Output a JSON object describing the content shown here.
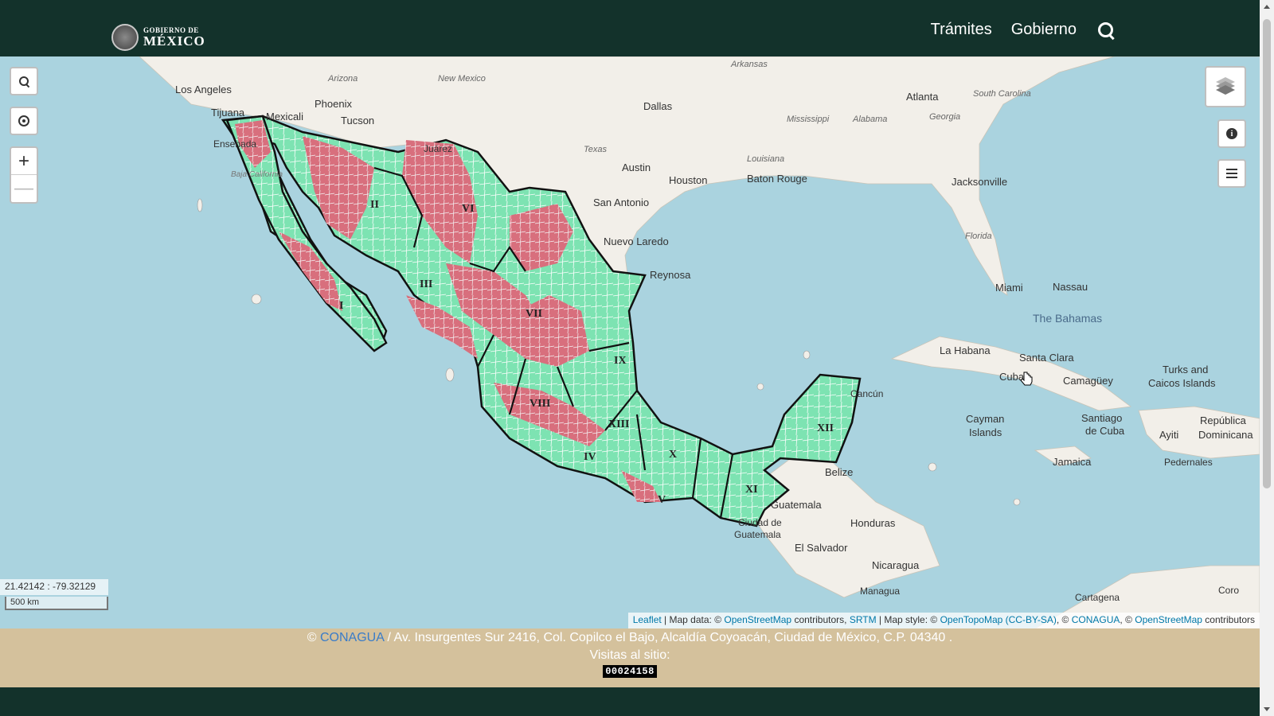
{
  "header": {
    "logo_line1": "GOBIERNO DE",
    "logo_line2": "MÉXICO",
    "nav": [
      "Trámites",
      "Gobierno"
    ]
  },
  "map": {
    "coordinates": "21.42142 : -79.32129",
    "scale": "500 km",
    "attribution": {
      "leaflet": "Leaflet",
      "sep1": " | Map data: © ",
      "osm": "OpenStreetMap",
      "contrib1": " contributors, ",
      "srtm": "SRTM",
      "style": " | Map style: © ",
      "otm": "OpenTopoMap (CC-BY-SA)",
      "sep2": ", © ",
      "conagua": "CONAGUA",
      "sep3": ", © ",
      "osm2": "OpenStreetMap",
      "contrib2": " contributors"
    },
    "colors": {
      "water": "#aad3df",
      "land": "#f2efe9",
      "region_ok": "#7de3b2",
      "region_alert": "#d86f7d"
    },
    "region_labels": [
      "I",
      "II",
      "III",
      "IV",
      "V",
      "VI",
      "VII",
      "VIII",
      "IX",
      "X",
      "XI",
      "XII",
      "XIII"
    ],
    "place_labels": [
      "Los Angeles",
      "Arizona",
      "New Mexico",
      "Phoenix",
      "Tucson",
      "Tijuana",
      "Mexicali",
      "Dallas",
      "Arkansas",
      "Mississippi",
      "Alabama",
      "Atlanta",
      "Georgia",
      "South Carolina",
      "Texas",
      "Austin",
      "Houston",
      "Louisiana",
      "Baton Rouge",
      "Jacksonville",
      "San Antonio",
      "Florida",
      "Nuevo Laredo",
      "Reynosa",
      "Miami",
      "Nassau",
      "The Bahamas",
      "La Habana",
      "Santa Clara",
      "Cuba",
      "Camagüey",
      "Turks and",
      "Caicos Islands",
      "Cayman",
      "Islands",
      "Santiago",
      "de Cuba",
      "República",
      "Dominicana",
      "Ayiti",
      "Jamaica",
      "Pedernales",
      "Belize",
      "Guatemala",
      "Honduras",
      "Ciudad de",
      "Guatemala",
      "El Salvador",
      "Nicaragua",
      "Managua",
      "Cartagena",
      "Coro",
      "Cancún",
      "Ensenada",
      "Baja California",
      "Juárez"
    ]
  },
  "footer": {
    "copyright": "© ",
    "org": "CONAGUA",
    "address": " / Av. Insurgentes Sur 2416, Col. Copilco el Bajo, Alcaldía Coyoacán, Ciudad de México, C.P. 04340 .",
    "visits_label": "Visitas al sitio:",
    "visits_count": "00024158"
  }
}
